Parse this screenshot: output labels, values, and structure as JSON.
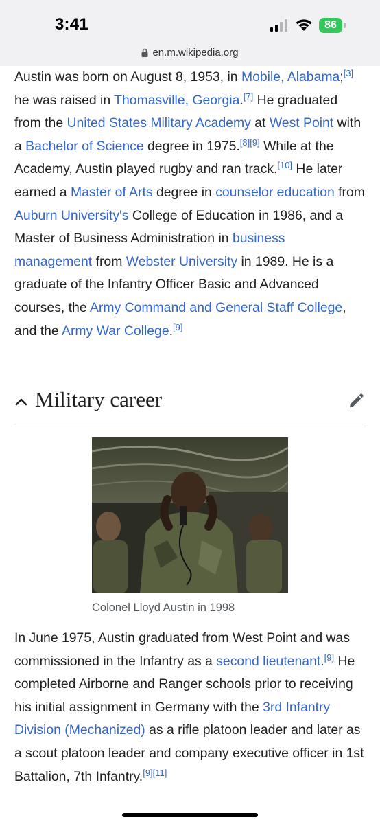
{
  "status": {
    "time": "3:41",
    "battery": "86"
  },
  "browser": {
    "url": "en.m.wikipedia.org"
  },
  "intro": {
    "s1": "Austin was born on August 8, 1953, in ",
    "l1": "Mobile, Alabama",
    "s2": ";",
    "r1": "[3]",
    "s3": " he was raised in ",
    "l2": "Thomasville, Georgia",
    "s4": ".",
    "r2": "[7]",
    "s5": " He graduated from the ",
    "l3": "United States Military Academy",
    "s6": " at ",
    "l4": "West Point",
    "s7": " with a ",
    "l5": "Bachelor of Science",
    "s8": " degree in 1975.",
    "r3": "[8]",
    "r4": "[9]",
    "s9": " While at the Academy, Austin played rugby and ran track.",
    "r5": "[10]",
    "s10": " He later earned a ",
    "l6": "Master of Arts",
    "s11": " degree in ",
    "l7": "counselor education",
    "s12": " from ",
    "l8": "Auburn University's",
    "s13": " College of Education in 1986, and a Master of Business Administration in ",
    "l9": "business management",
    "s14": " from ",
    "l10": "Webster University",
    "s15": " in 1989. He is a graduate of the Infantry Officer Basic and Advanced courses, the ",
    "l11": "Army Command and General Staff College",
    "s16": ", and the ",
    "l12": "Army War College",
    "s17": ".",
    "r6": "[9]"
  },
  "section": {
    "title": "Military career"
  },
  "figure": {
    "caption": "Colonel Lloyd Austin in 1998"
  },
  "career": {
    "s1": "In June 1975, Austin graduated from West Point and was commissioned in the Infantry as a ",
    "l1": "second lieutenant",
    "s2": ".",
    "r1": "[9]",
    "s3": " He completed Airborne and Ranger schools prior to receiving his initial assignment in Germany with the ",
    "l2": "3rd Infantry Division (Mechanized)",
    "s4": " as a rifle platoon leader and later as a scout platoon leader and company executive officer in 1st Battalion, 7th Infantry.",
    "r2": "[9]",
    "r3": "[11]"
  }
}
